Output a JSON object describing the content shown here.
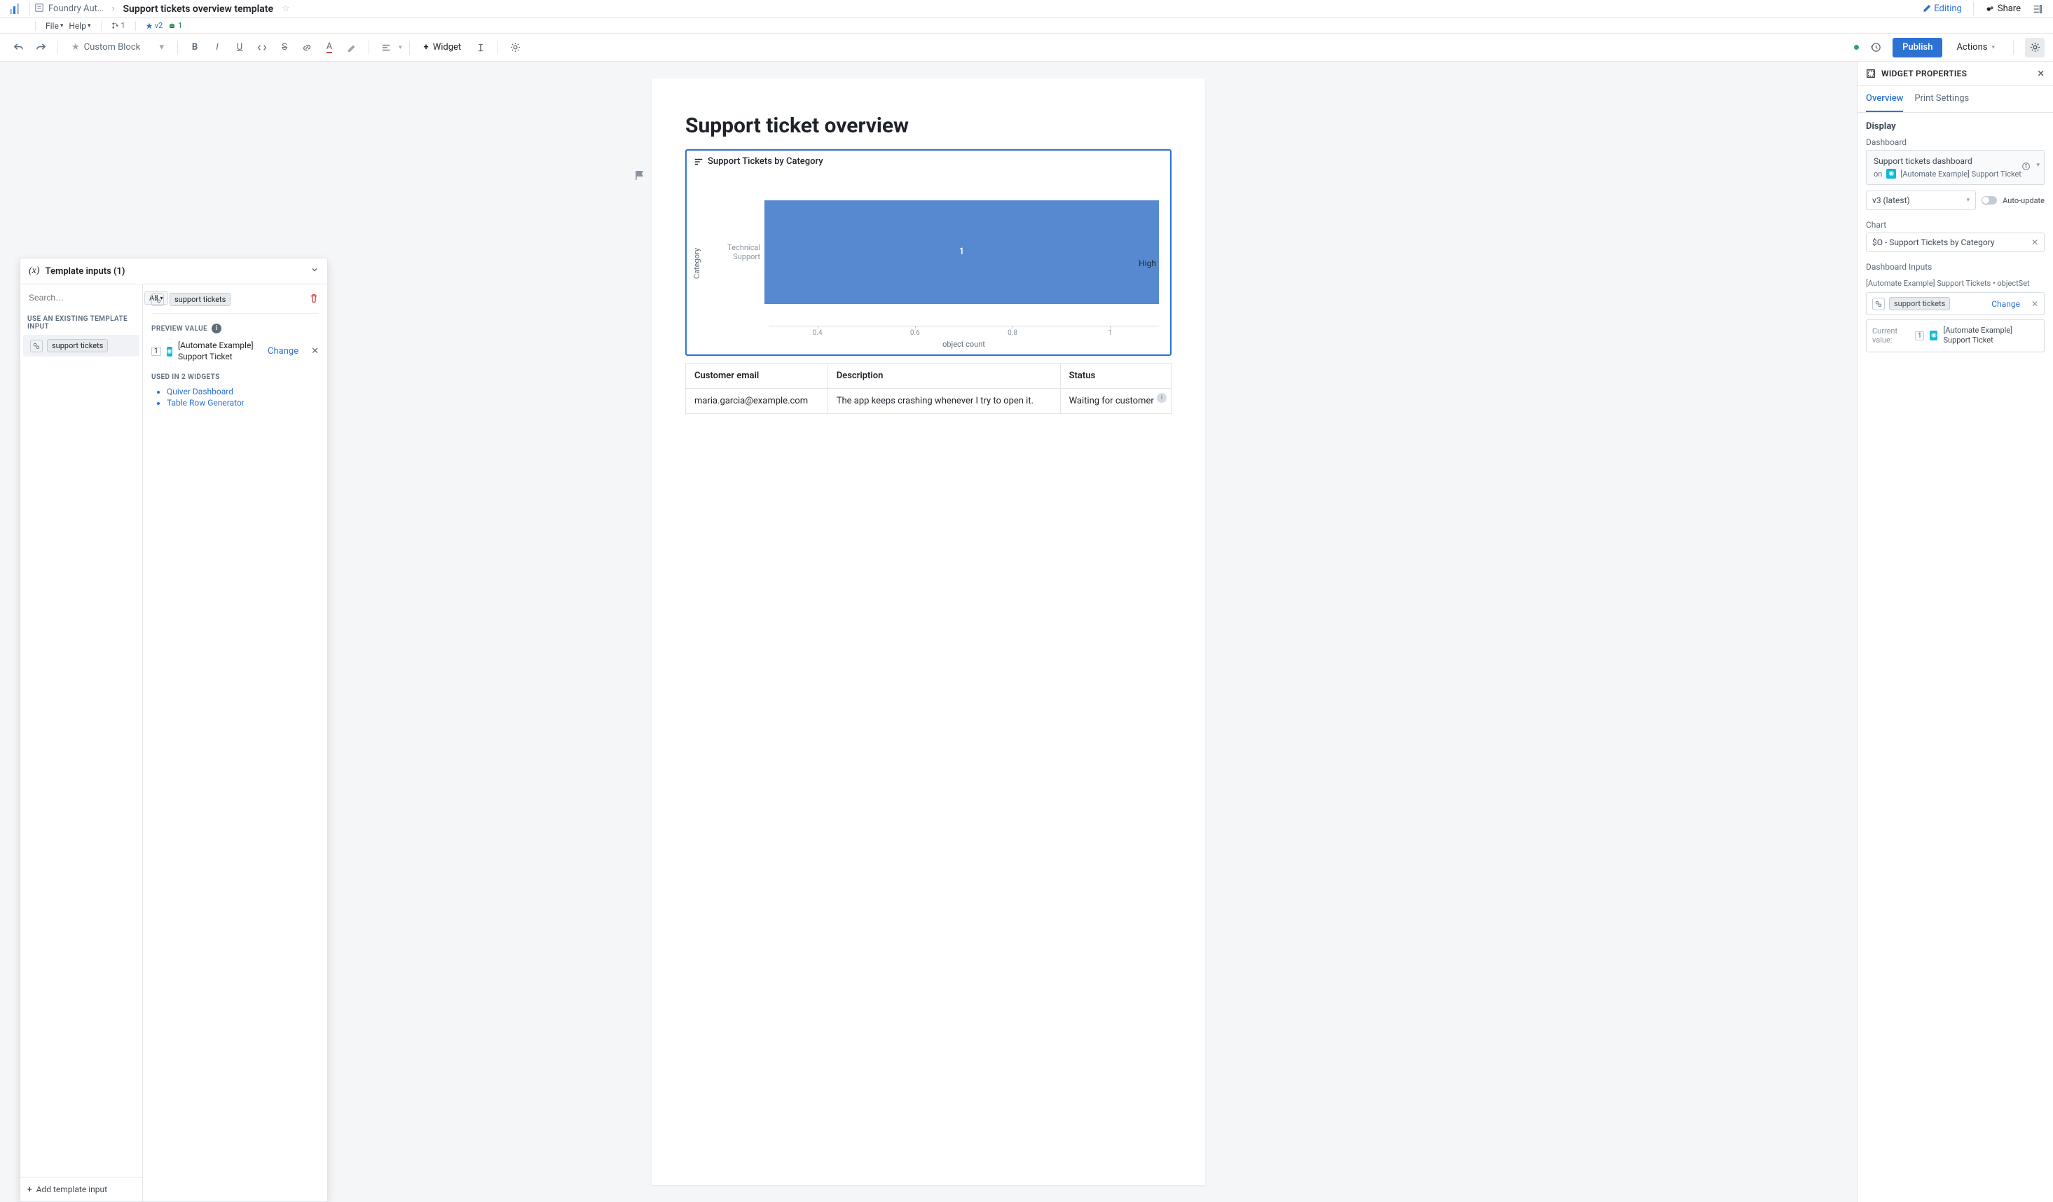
{
  "breadcrumb": {
    "parent": "Foundry Aut…",
    "title": "Support tickets overview template"
  },
  "menubar": {
    "file": "File",
    "help": "Help",
    "count1": "1",
    "version": "v2",
    "count2": "1"
  },
  "top_actions": {
    "editing": "Editing",
    "share": "Share"
  },
  "toolbar": {
    "custom_block": "Custom Block",
    "widget": "Widget",
    "publish": "Publish",
    "actions": "Actions"
  },
  "page": {
    "heading": "Support ticket overview"
  },
  "chart_widget": {
    "title": "Support Tickets by Category",
    "xlabel": "object count",
    "ylabel": "Category",
    "category": "Technical Support",
    "bar_label": "1",
    "legend": "High",
    "ticks": [
      "0.4",
      "0.6",
      "0.8",
      "1"
    ]
  },
  "chart_data": {
    "type": "bar",
    "orientation": "horizontal",
    "categories": [
      "Technical Support"
    ],
    "series": [
      {
        "name": "High",
        "values": [
          1
        ]
      }
    ],
    "xlabel": "object count",
    "ylabel": "Category",
    "xlim": [
      0,
      1
    ],
    "title": "Support Tickets by Category"
  },
  "table": {
    "headers": [
      "Customer email",
      "Description",
      "Status"
    ],
    "rows": [
      {
        "email": "maria.garcia@example.com",
        "desc": "The app keeps crashing whenever I try to open it.",
        "status": "Waiting for customer"
      }
    ]
  },
  "side": {
    "title": "WIDGET PROPERTIES",
    "tabs": {
      "overview": "Overview",
      "print": "Print Settings"
    },
    "display": "Display",
    "dashboard_label": "Dashboard",
    "dashboard_name": "Support tickets dashboard",
    "dashboard_on": "on",
    "dashboard_obj": "[Automate Example] Support Ticket",
    "version": "v3 (latest)",
    "auto_update": "Auto-update",
    "chart_label": "Chart",
    "chart_value": "$O - Support Tickets by Category",
    "inputs_label": "Dashboard Inputs",
    "inputs_source": "[Automate Example] Support Tickets • objectSet",
    "input_chip": "support tickets",
    "change": "Change",
    "current_value": "Current value:",
    "current_count": "1",
    "current_obj": "[Automate Example] Support Ticket"
  },
  "float": {
    "title": "Template inputs (1)",
    "search_placeholder": "Search…",
    "all": "All",
    "existing_hdr": "USE AN EXISTING TEMPLATE INPUT",
    "support_tickets": "support tickets",
    "add": "Add template input",
    "preview_hdr": "PREVIEW VALUE",
    "preview_count": "1",
    "preview_name": "[Automate Example] Support Ticket",
    "change": "Change",
    "used_hdr": "USED IN 2 WIDGETS",
    "used_list": [
      "Quiver Dashboard",
      "Table Row Generator"
    ]
  }
}
